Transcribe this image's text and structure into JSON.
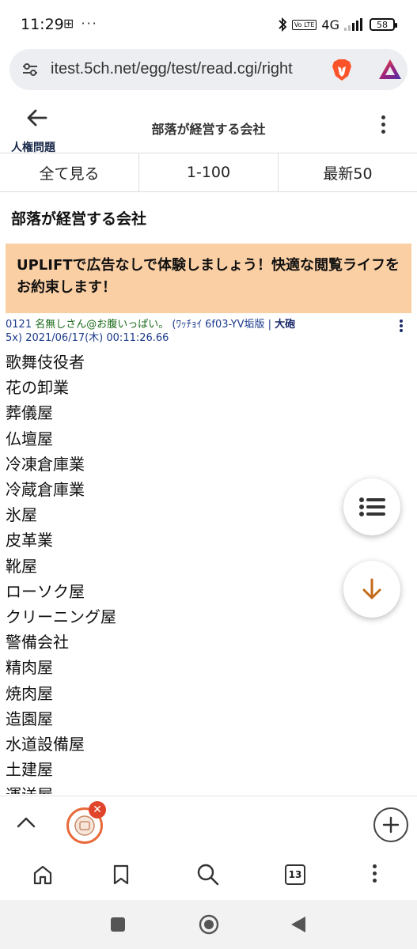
{
  "status_bar": {
    "time": "11:29",
    "left_icons": "⊞ ···",
    "network": "4G",
    "volte": "Vo LTE",
    "battery": "58"
  },
  "url_bar": {
    "url": "itest.5ch.net/egg/test/read.cgi/right"
  },
  "header": {
    "back_label": "人権問題",
    "title": "部落が経営する会社"
  },
  "tabs": [
    {
      "label": "全て見る"
    },
    {
      "label": "1-100"
    },
    {
      "label": "最新50"
    }
  ],
  "thread_title": "部落が経営する会社",
  "ad_banner": {
    "text": "UPLIFTで広告なしで体験しましょう！快適な閲覧ライフをお約束します！"
  },
  "post": {
    "number": "0121",
    "name": "名無しさん@お腹いっぱい。",
    "id_info": "(ﾜｯﾁｮｲ 6f03-YV垢版",
    "separator": "|",
    "cannon": "大砲",
    "continuation": "5x)",
    "datetime": "2021/06/17(木) 00:11:26.66",
    "lines": [
      "歌舞伎役者",
      "花の卸業",
      "葬儀屋",
      "仏壇屋",
      "冷凍倉庫業",
      "冷蔵倉庫業",
      "氷屋",
      "皮革業",
      "靴屋",
      "ローソク屋",
      "クリーニング屋",
      "警備会社",
      "精肉屋",
      "焼肉屋",
      "造園屋",
      "水道設備屋",
      "土建屋",
      "運送屋"
    ]
  },
  "bottom_toolbar": {
    "tab_count": "13"
  },
  "icons": {
    "tune": "tune-icon",
    "brave": "brave-lion-icon",
    "rewards": "brave-rewards-triangle-icon",
    "back": "arrow-left-icon",
    "list": "list-icon",
    "down": "arrow-down-icon",
    "home": "home-icon",
    "bookmark": "bookmark-icon",
    "search": "search-icon"
  },
  "colors": {
    "ad_background": "#fbcfa4",
    "down_arrow": "#c46a1a",
    "link_blue": "#1a3a8a",
    "brave_orange": "#fb542b"
  }
}
